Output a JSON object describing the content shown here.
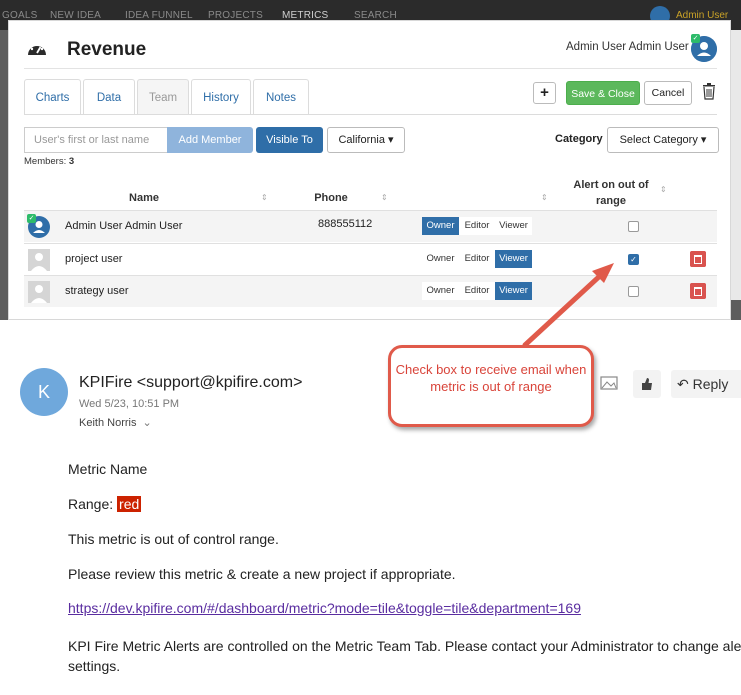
{
  "appbar": {
    "nav": [
      "GOALS",
      "NEW IDEA",
      "IDEA FUNNEL",
      "PROJECTS",
      "METRICS",
      "SEARCH"
    ],
    "user": "Admin User"
  },
  "modal": {
    "title": "Revenue",
    "current_user": "Admin User Admin User",
    "tabs": [
      "Charts",
      "Data",
      "Team",
      "History",
      "Notes"
    ],
    "active_tab": "Team",
    "plus_label": "+",
    "save_label": "Save & Close",
    "cancel_label": "Cancel",
    "search_placeholder": "User's first or last name",
    "add_member_label": "Add Member",
    "visible_to_label": "Visible To",
    "state_label": "California ▾",
    "category_label": "Category",
    "category_select": "Select Category ▾",
    "members_label": "Members:",
    "members_count": "3",
    "columns": {
      "name": "Name",
      "phone": "Phone",
      "alert": "Alert on out of range"
    },
    "roles": [
      "Owner",
      "Editor",
      "Viewer"
    ],
    "rows": [
      {
        "name": "Admin User Admin User",
        "phone": "888555112",
        "role": "Owner",
        "alert": false,
        "avatar": "user-blue"
      },
      {
        "name": "project user",
        "phone": "",
        "role": "Viewer",
        "alert": true,
        "avatar": "user-gray"
      },
      {
        "name": "strategy user",
        "phone": "",
        "role": "Viewer",
        "alert": false,
        "avatar": "user-gray"
      }
    ]
  },
  "callout": {
    "text": "Check box to receive email when metric is out of range",
    "color": "#e05a4a"
  },
  "email": {
    "avatar_letter": "K",
    "from": "KPIFire <support@kpifire.com>",
    "date": "Wed 5/23, 10:51 PM",
    "to": "Keith Norris",
    "reply_label": "Reply",
    "metric_name": "Metric Name",
    "range_label": "Range:",
    "range_value": "red",
    "line1": "This metric is out of control range.",
    "line2": "Please review this metric & create a new project if appropriate.",
    "link": "https://dev.kpifire.com/#/dashboard/metric?mode=tile&toggle=tile&department=169",
    "footer": "KPI Fire Metric Alerts are controlled on the Metric Team Tab. Please contact your Administrator to change alert settings."
  },
  "colors": {
    "primary": "#2f6ea8",
    "success": "#5cb85c",
    "danger": "#d9534f",
    "range_red": "#cc2200"
  }
}
